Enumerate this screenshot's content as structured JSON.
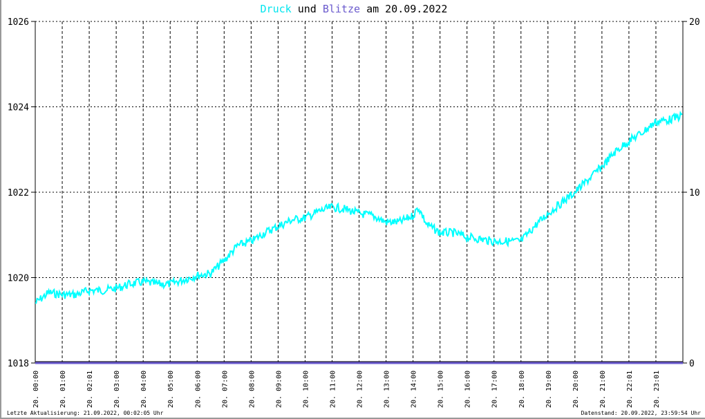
{
  "chart_data": {
    "type": "line",
    "title": {
      "part1": "Druck",
      "part2": "und",
      "part3": "Blitze",
      "part4": "am 20.09.2022"
    },
    "y_left": {
      "range": [
        1018,
        1026
      ],
      "ticks": [
        "1018",
        "1020",
        "1022",
        "1024",
        "1026"
      ]
    },
    "y_right": {
      "range": [
        0,
        20
      ],
      "ticks": [
        "0",
        "10",
        "20"
      ]
    },
    "x_ticks": [
      "20. 00:00",
      "20. 01:00",
      "20. 02:01",
      "20. 03:00",
      "20. 04:00",
      "20. 05:00",
      "20. 06:00",
      "20. 07:00",
      "20. 08:00",
      "20. 09:00",
      "20. 10:00",
      "20. 11:00",
      "20. 12:00",
      "20. 13:00",
      "20. 14:00",
      "20. 15:00",
      "20. 16:00",
      "20. 17:00",
      "20. 18:00",
      "20. 19:00",
      "20. 20:00",
      "20. 21:00",
      "20. 22:01",
      "20. 23:01"
    ],
    "grid": true,
    "series": [
      {
        "name": "Druck",
        "color": "#00ffff",
        "x_hours": [
          0,
          0.5,
          1,
          1.5,
          2,
          2.5,
          3,
          3.5,
          4,
          4.5,
          5,
          5.5,
          6,
          6.5,
          7,
          7.5,
          8,
          8.5,
          9,
          9.5,
          10,
          10.5,
          11,
          11.5,
          12,
          12.5,
          13,
          13.5,
          14,
          14.2,
          14.5,
          15,
          15.5,
          16,
          16.5,
          17,
          17.5,
          18,
          18.5,
          19,
          19.5,
          20,
          20.5,
          21,
          21.5,
          22,
          22.5,
          23,
          23.5,
          24
        ],
        "values": [
          1019.4,
          1019.65,
          1019.6,
          1019.6,
          1019.7,
          1019.7,
          1019.75,
          1019.85,
          1019.9,
          1019.85,
          1019.85,
          1019.95,
          1020.05,
          1020.1,
          1020.4,
          1020.75,
          1020.85,
          1021.05,
          1021.2,
          1021.35,
          1021.4,
          1021.55,
          1021.65,
          1021.6,
          1021.5,
          1021.45,
          1021.3,
          1021.3,
          1021.45,
          1021.65,
          1021.25,
          1021.05,
          1021.05,
          1020.95,
          1020.9,
          1020.85,
          1020.85,
          1020.85,
          1021.2,
          1021.5,
          1021.75,
          1022.0,
          1022.3,
          1022.6,
          1022.95,
          1023.2,
          1023.4,
          1023.65,
          1023.7,
          1023.8
        ]
      },
      {
        "name": "Blitze",
        "color": "#6a5acd",
        "axis": "right",
        "values_constant": 0
      }
    ]
  },
  "footer": {
    "left": "Letzte Aktualisierung: 21.09.2022, 00:02:05 Uhr",
    "right": "Datenstand: 20.09.2022, 23:59:54 Uhr"
  }
}
